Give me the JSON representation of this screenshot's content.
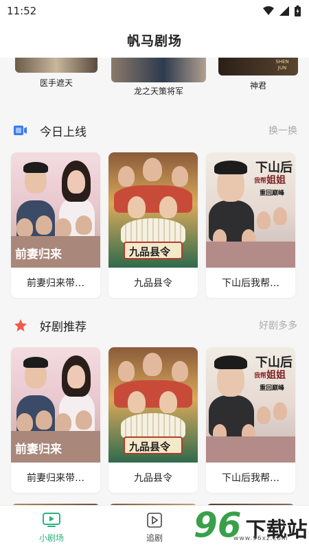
{
  "status_bar": {
    "time": "11:52"
  },
  "header": {
    "title": "帆马剧场"
  },
  "top_strip": {
    "items": [
      {
        "label": "医手遮天"
      },
      {
        "label": "龙之天策将军"
      },
      {
        "label": "神君",
        "poster_text": "SHEN JUN"
      }
    ]
  },
  "sections": [
    {
      "title": "今日上线",
      "more": "换一换",
      "cards": [
        {
          "title": "前妻归来带…"
        },
        {
          "title": "九品县令"
        },
        {
          "title": "下山后我帮…"
        }
      ]
    },
    {
      "title": "好剧推荐",
      "more": "好剧多多",
      "cards": [
        {
          "title": "前妻归来带…"
        },
        {
          "title": "九品县令"
        },
        {
          "title": "下山后我帮…"
        }
      ]
    }
  ],
  "posters": {
    "a_text": "前妻归来",
    "b_text": "九品县令",
    "c_text": "下山后",
    "c_sub1": "我帮",
    "c_sub2": "姐姐",
    "c_sub3": "重回巅峰"
  },
  "bottom_nav": {
    "items": [
      {
        "label": "小剧场",
        "active": true
      },
      {
        "label": "追剧",
        "active": false
      }
    ]
  },
  "watermark": {
    "number": "96",
    "text": "下载站",
    "url": "www.96xz.com"
  },
  "colors": {
    "accent": "#27b37c",
    "section_icon_blue": "#3a7bf0",
    "section_icon_red": "#f05a4a"
  }
}
